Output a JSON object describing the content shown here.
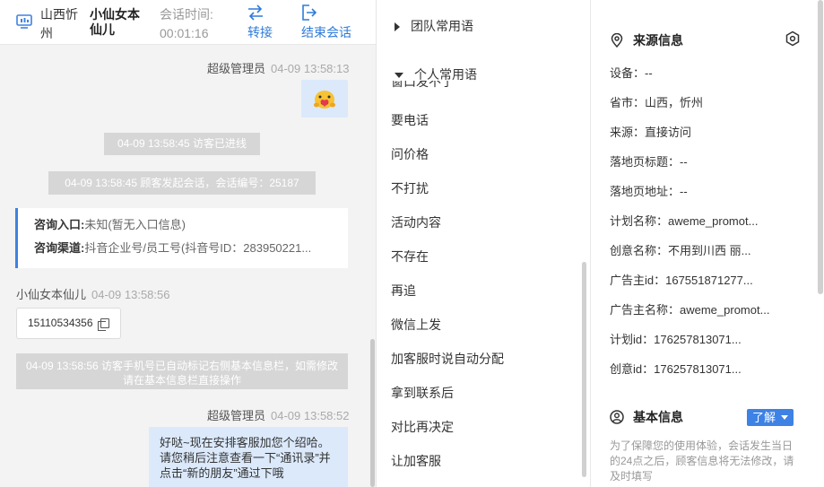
{
  "header": {
    "location": "山西忻州",
    "visitor_name": "小仙女本仙儿",
    "duration_label": "会话时间:",
    "duration_value": "00:01:16",
    "transfer_label": "转接",
    "end_label": "结束会话",
    "accent_color": "#2f7bd8"
  },
  "messages": {
    "agent1_name": "超级管理员",
    "agent1_time": "04-09 13:58:13",
    "sys1": "04-09 13:58:45 访客已进线",
    "sys2": "04-09 13:58:45 顾客发起会话，会话编号：25187",
    "entry_key": "咨询入口:",
    "entry_val": "未知(暂无入口信息)",
    "channel_key": "咨询渠道:",
    "channel_val": "抖音企业号/员工号(抖音号ID：283950221...",
    "visitor_name": "小仙女本仙儿",
    "visitor_time": "04-09 13:58:56",
    "phone": "15110534356",
    "sys3": "04-09 13:58:56 访客手机号已自动标记右侧基本信息栏，如需修改请在基本信息栏直接操作",
    "agent2_name": "超级管理员",
    "agent2_time": "04-09 13:58:52",
    "agent2_text": "好哒~现在安排客服加您个绍哈。请您稍后注意查看一下“通讯录”并点击“新的朋友”通过下哦"
  },
  "phrases": {
    "team_group": "团队常用语",
    "personal_group": "个人常用语",
    "partial_item": "窗口发不了",
    "items": [
      "要电话",
      "问价格",
      "不打扰",
      "活动内容",
      "不存在",
      "再追",
      "微信上发",
      "加客服时说自动分配",
      "拿到联系后",
      "对比再决定",
      "让加客服"
    ]
  },
  "source_info": {
    "title": "来源信息",
    "rows": [
      "设备：--",
      "省市：山西，忻州",
      "来源：直接访问",
      "落地页标题：--",
      "落地页地址：--",
      "计划名称：aweme_promot...",
      "创意名称：不用到川西 丽...",
      "广告主id：167551871277...",
      "广告主名称：aweme_promot...",
      "计划id：176257813071...",
      "创意id：176257813071..."
    ]
  },
  "basic_info": {
    "title": "基本信息",
    "know_label": "了解",
    "notice": "为了保障您的使用体验，会话发生当日的24点之后，顾客信息将无法修改，请及时填写"
  },
  "icons": {
    "header": "monitor-icon",
    "transfer": "transfer-arrows-icon",
    "end": "exit-icon",
    "source": "location-pin-icon",
    "settings": "hexagon-gear-icon",
    "basic": "user-circle-icon",
    "emoji": "heart-hug-emoji-icon",
    "copy": "copy-icon"
  }
}
